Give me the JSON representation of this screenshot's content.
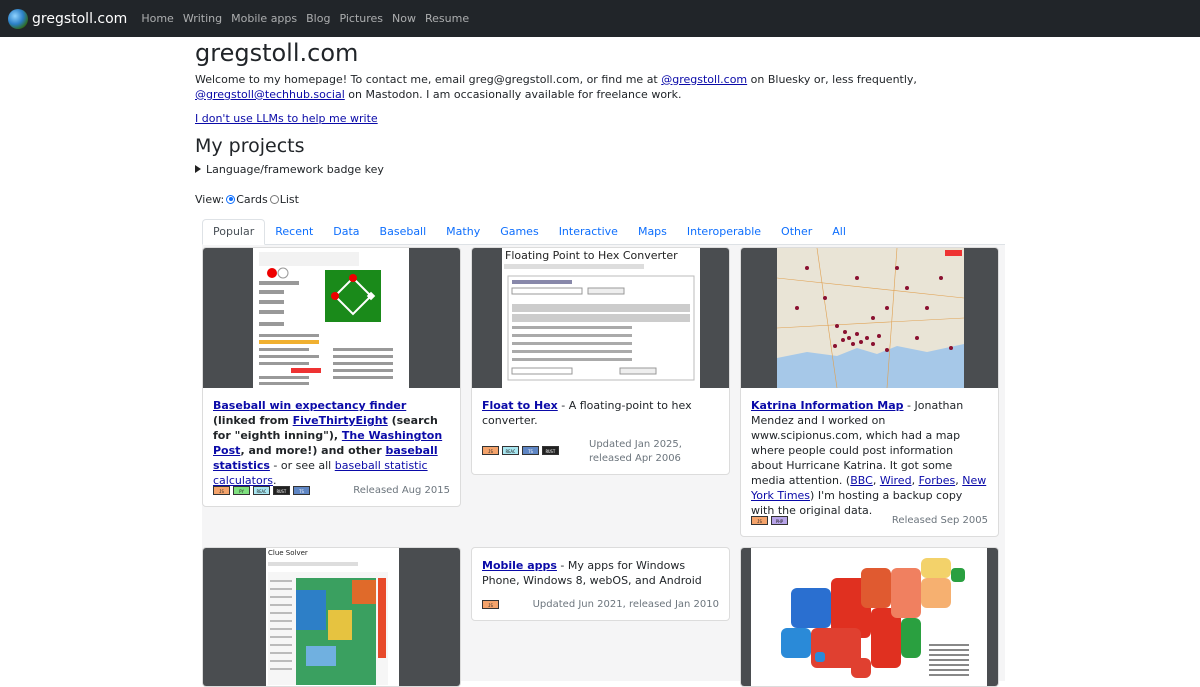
{
  "nav": {
    "brand": "gregstoll.com",
    "links": [
      "Home",
      "Writing",
      "Mobile apps",
      "Blog",
      "Pictures",
      "Now",
      "Resume"
    ]
  },
  "header": {
    "title": "gregstoll.com",
    "intro_before": "Welcome to my homepage! To contact me, email greg@gregstoll.com, or find me at ",
    "bluesky_link": "@gregstoll.com",
    "intro_middle": " on Bluesky or, less frequently, ",
    "mastodon_link": "@gregstoll@techhub.social",
    "intro_after": " on Mastodon. I am occasionally available for freelance work.",
    "llm_link": "I don't use LLMs to help me write"
  },
  "projects": {
    "heading": "My projects",
    "badge_key": "Language/framework badge key",
    "view_label": "View:",
    "view_options": [
      "Cards",
      "List"
    ],
    "view_selected": "Cards"
  },
  "tabs": [
    "Popular",
    "Recent",
    "Data",
    "Baseball",
    "Mathy",
    "Games",
    "Interactive",
    "Maps",
    "Interoperable",
    "Other",
    "All"
  ],
  "active_tab": "Popular",
  "cards": [
    {
      "link1": "Baseball win expectancy finder",
      "text1": " (linked from ",
      "link2": "FiveThirtyEight",
      "text2": " (search for \"eighth inning\"), ",
      "link3": "The Washington Post",
      "text3": ", and more!) and other ",
      "link4": "baseball statistics",
      "text4": " - or see all ",
      "link5": "baseball statistic calculators",
      "text5": ".",
      "badges": [
        "JS",
        "PY",
        "REAC",
        "RUST",
        "TS"
      ],
      "released": "Released Aug 2015"
    },
    {
      "link1": "Float to Hex",
      "text1": " - A floating-point to hex converter.",
      "badges": [
        "JS",
        "REAC",
        "TS",
        "RUST"
      ],
      "released": "Updated Jan 2025, released Apr 2006",
      "thumb_title": "Floating Point to Hex Converter"
    },
    {
      "link1": "Katrina Information Map",
      "text1": " - Jonathan Mendez and I worked on www.scipionus.com, which had a map where people could post information about Hurricane Katrina. It got some media attention. (",
      "link2": "BBC",
      "sep1": ", ",
      "link3": "Wired",
      "sep2": ", ",
      "link4": "Forbes",
      "sep3": ", ",
      "link5": "New York Times",
      "text2": ") I'm hosting a backup copy with the original data.",
      "badges": [
        "JS",
        "PHP"
      ],
      "released": "Released Sep 2005"
    },
    {
      "thumb_title": "Clue Solver"
    },
    {
      "link1": "Mobile apps",
      "text1": " - My apps for Windows Phone, Windows 8, webOS, and Android",
      "badges": [
        "JS"
      ],
      "released": "Updated Jun 2021, released Jan 2010"
    },
    {}
  ],
  "badge_colors": {
    "JS": "#f4a36b",
    "PY": "#7fe07f",
    "REAC": "#a8e6f0",
    "RUST": "#222222",
    "TS": "#5f86c4",
    "PHP": "#b7a3e8"
  }
}
